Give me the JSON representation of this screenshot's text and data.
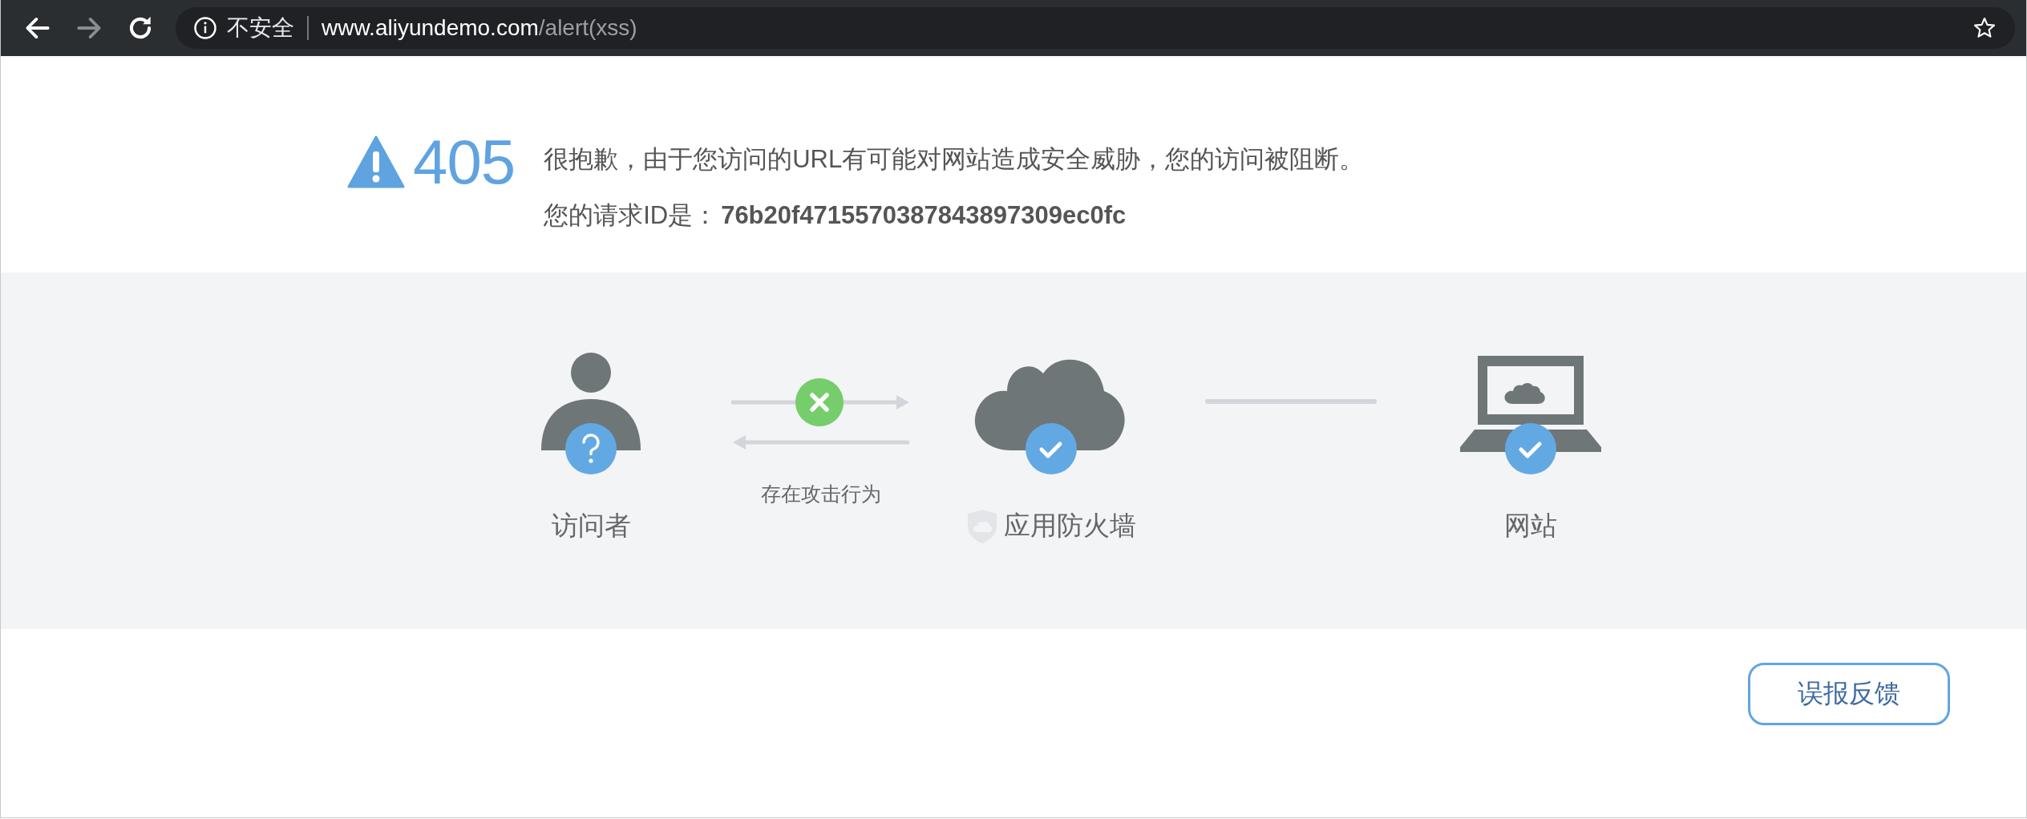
{
  "browser": {
    "nav_buttons": [
      {
        "kind": "back",
        "disabled": false
      },
      {
        "kind": "forward",
        "disabled": true
      },
      {
        "kind": "reload",
        "disabled": false
      }
    ],
    "address": {
      "security_label": "不安全",
      "host": "www.aliyundemo.com",
      "path": "/alert(xss)"
    }
  },
  "error": {
    "code": "405",
    "message": "很抱歉，由于您访问的URL有可能对网站造成安全威胁，您的访问被阻断。",
    "request_id_label": "您的请求ID是：",
    "request_id": "76b20f4715570387843897309ec0fc"
  },
  "diagram": {
    "items": [
      {
        "kind": "visitor",
        "verified": false,
        "label": "访问者"
      },
      {
        "kind": "blocked-link",
        "label": "存在攻击行为"
      },
      {
        "kind": "firewall",
        "verified": true,
        "label": "应用防火墙"
      },
      {
        "kind": "plain-link"
      },
      {
        "kind": "website",
        "verified": true,
        "label": "网站"
      }
    ]
  },
  "feedback_button": "误报反馈"
}
